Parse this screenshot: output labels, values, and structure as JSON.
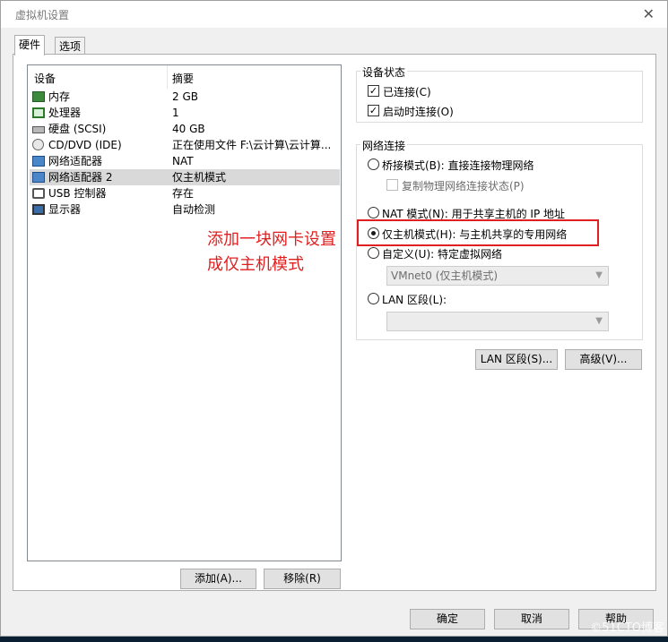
{
  "window": {
    "title": "虚拟机设置",
    "close_glyph": "✕"
  },
  "tabs": [
    {
      "label": "硬件",
      "active": true
    },
    {
      "label": "选项",
      "active": false
    }
  ],
  "device_list": {
    "headers": {
      "device": "设备",
      "summary": "摘要"
    },
    "rows": [
      {
        "name": "内存",
        "summary": "2 GB",
        "icon": "memory-icon"
      },
      {
        "name": "处理器",
        "summary": "1",
        "icon": "cpu-icon"
      },
      {
        "name": "硬盘 (SCSI)",
        "summary": "40 GB",
        "icon": "hard-disk-icon"
      },
      {
        "name": "CD/DVD (IDE)",
        "summary": "正在使用文件 F:\\云计算\\云计算...",
        "icon": "cd-dvd-icon"
      },
      {
        "name": "网络适配器",
        "summary": "NAT",
        "icon": "network-adapter-icon"
      },
      {
        "name": "网络适配器 2",
        "summary": "仅主机模式",
        "icon": "network-adapter-icon",
        "selected": true
      },
      {
        "name": "USB 控制器",
        "summary": "存在",
        "icon": "usb-icon"
      },
      {
        "name": "显示器",
        "summary": "自动检测",
        "icon": "display-icon"
      }
    ]
  },
  "buttons": {
    "add": "添加(A)...",
    "remove": "移除(R)",
    "lan_segments": "LAN 区段(S)...",
    "advanced": "高级(V)...",
    "ok": "确定",
    "cancel": "取消",
    "help": "帮助"
  },
  "device_status": {
    "title": "设备状态",
    "connected": {
      "label": "已连接(C)",
      "checked": true
    },
    "connect_at_power_on": {
      "label": "启动时连接(O)",
      "checked": true
    }
  },
  "network_connection": {
    "title": "网络连接",
    "bridged": "桥接模式(B): 直接连接物理网络",
    "replicate": "复制物理网络连接状态(P)",
    "nat": "NAT 模式(N): 用于共享主机的 IP 地址",
    "host_only": "仅主机模式(H): 与主机共享的专用网络",
    "custom": "自定义(U): 特定虚拟网络",
    "custom_select_value": "VMnet0 (仅主机模式)",
    "lan_segment": "LAN 区段(L):",
    "selected": "host_only"
  },
  "annotation": {
    "line1": "添加一块网卡设置",
    "line2": "成仅主机模式",
    "color": "#e02020"
  },
  "watermark": "©51CTO博客"
}
